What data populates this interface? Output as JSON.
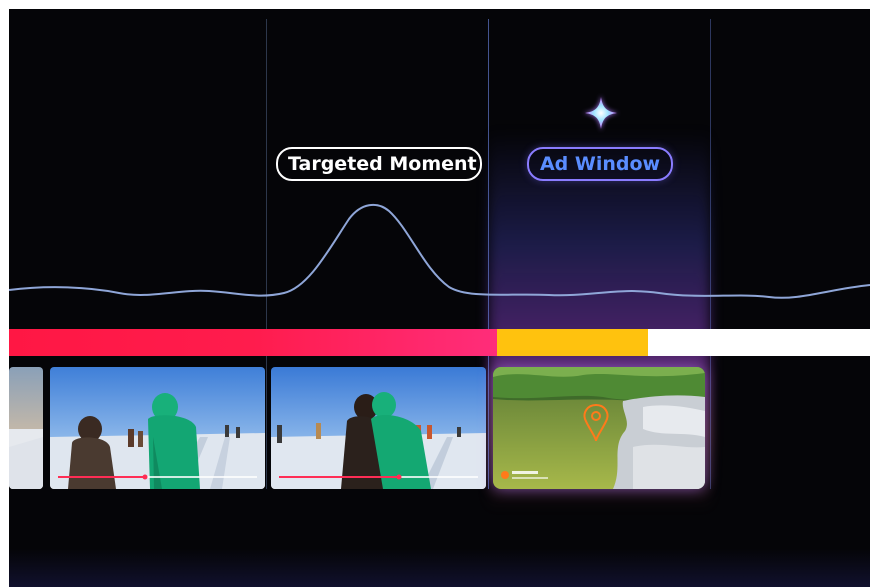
{
  "labels": {
    "targeted_moment": "Targeted Moment",
    "ad_window": "Ad Window"
  },
  "progress": {
    "played_fraction": 0.5668,
    "ad_fraction": 0.175
  },
  "icons": {
    "sparkle": "sparkle-icon",
    "location_pin": "location-pin-icon"
  },
  "colors": {
    "background": "#050508",
    "played": "#ff1744",
    "ad_segment": "#ffc20e",
    "unplayed": "#ffffff",
    "ad_label": "#5a8dff",
    "pin": "#ff7a1a"
  }
}
